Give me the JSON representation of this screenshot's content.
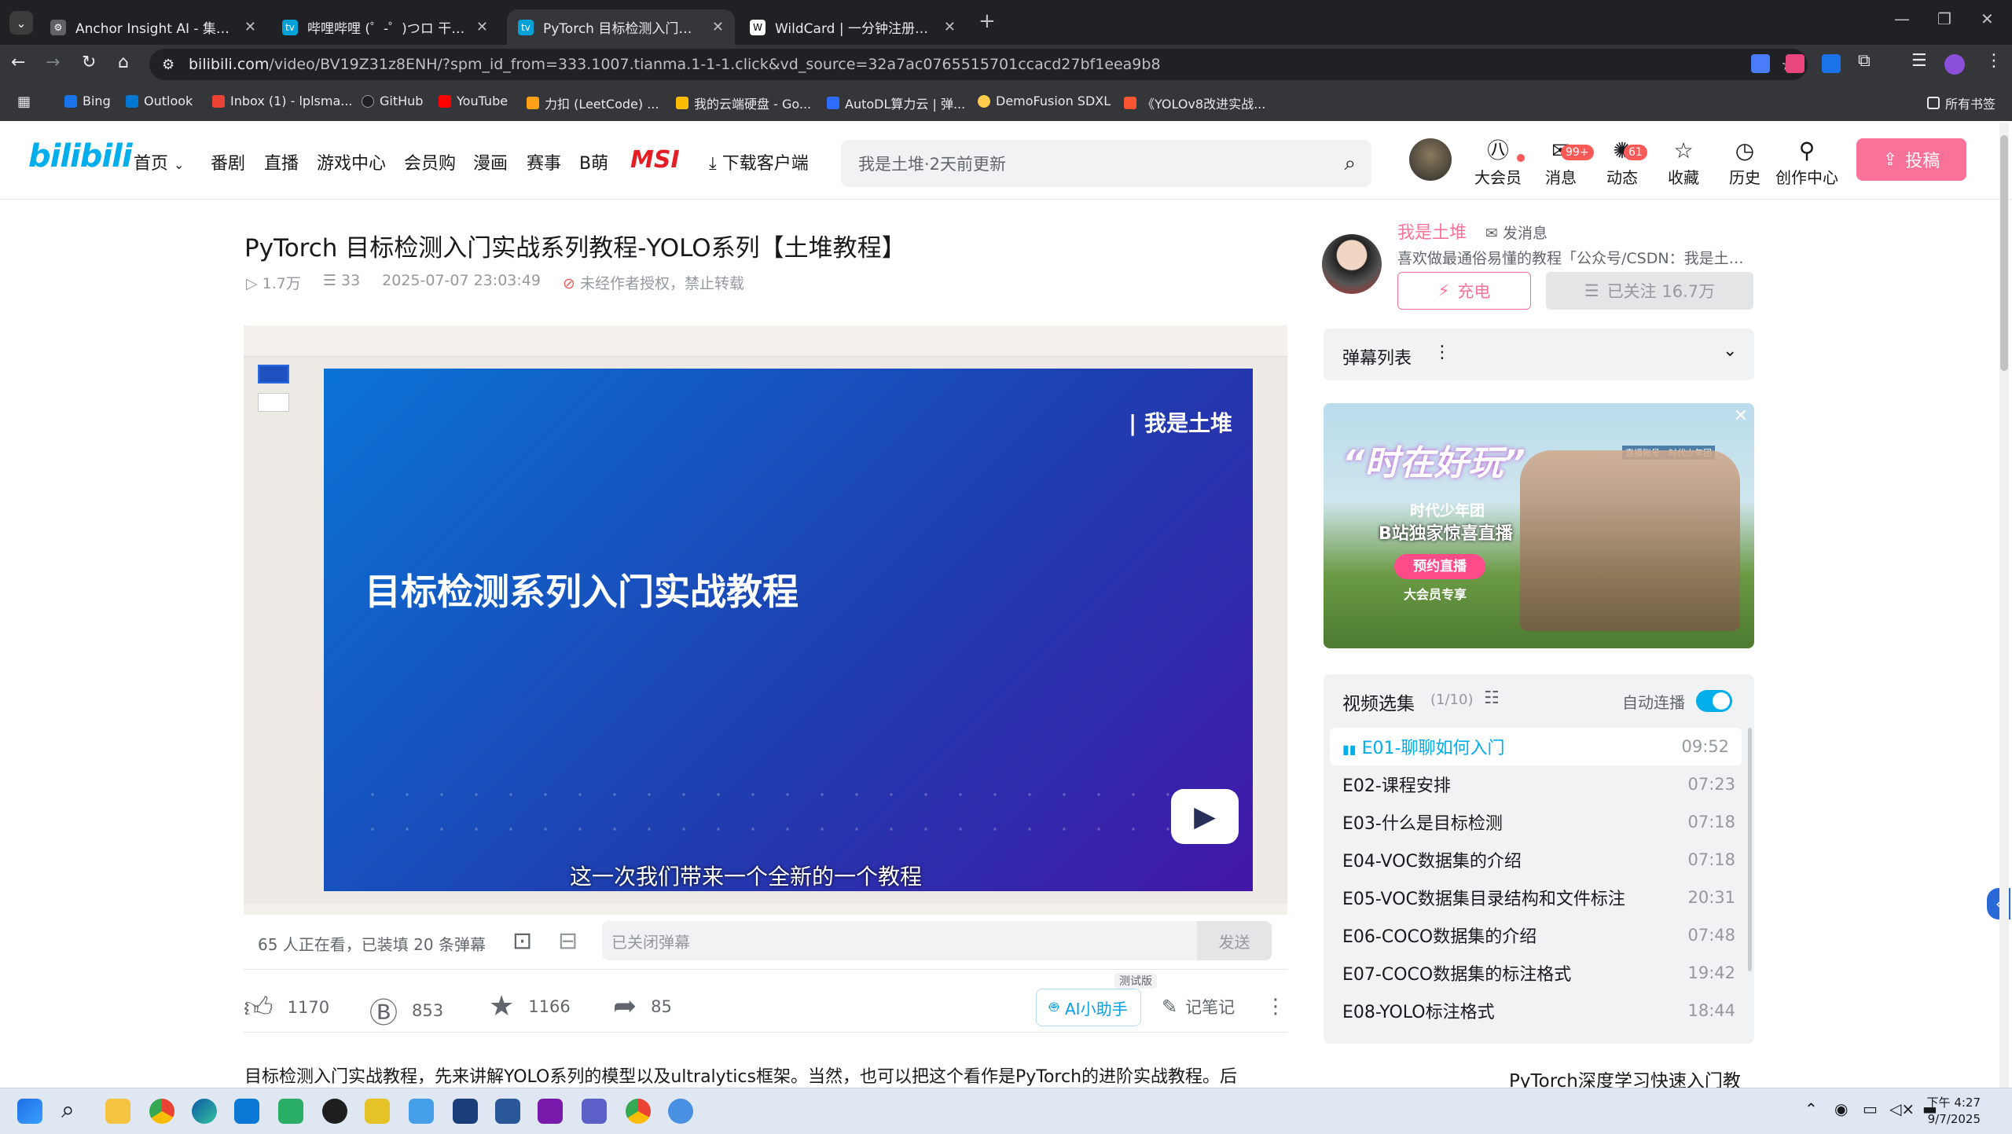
{
  "browser": {
    "tabs": [
      {
        "title": "Anchor Insight AI - 集中注意力",
        "color": "#5f6368",
        "active": false
      },
      {
        "title": "哔哩哔哩 (゜-゜)つロ 干杯~-bilibili",
        "color": "#00a1d6",
        "active": false
      },
      {
        "title": "PyTorch 目标检测入门实战系列教程",
        "color": "#00a1d6",
        "active": true
      },
      {
        "title": "WildCard | 一分钟注册，轻松订阅",
        "color": "#ffffff",
        "active": false
      }
    ],
    "url_host": "bilibili.com",
    "url_path": "/video/BV19Z31z8ENH/?spm_id_from=333.1007.tianma.1-1-1.click&vd_source=32a7ac0765515701ccacd27bf1eea9b8",
    "bookmarks": [
      {
        "label": "Bing",
        "color": "#1a73e8"
      },
      {
        "label": "Outlook",
        "color": "#0078d4"
      },
      {
        "label": "Inbox (1) - lplsma...",
        "color": "#ea4335"
      },
      {
        "label": "GitHub",
        "color": "#202124"
      },
      {
        "label": "YouTube",
        "color": "#ff0000"
      },
      {
        "label": "力扣 (LeetCode) ...",
        "color": "#ffa116"
      },
      {
        "label": "我的云端硬盘 - Go...",
        "color": "#fbbc04"
      },
      {
        "label": "AutoDL算力云 | 弹...",
        "color": "#2e6bff"
      },
      {
        "label": "DemoFusion SDXL",
        "color": "#ffcc4d"
      },
      {
        "label": "《YOLOv8改进实战...",
        "color": "#fc5531"
      }
    ],
    "all_bookmarks": "所有书签"
  },
  "header": {
    "logo": "bilibili",
    "nav": [
      "首页",
      "番剧",
      "直播",
      "游戏中心",
      "会员购",
      "漫画",
      "赛事",
      "B萌",
      "MSI",
      "下载客户端"
    ],
    "search_placeholder": "我是土堆·2天前更新",
    "icons": [
      {
        "label": "大会员",
        "icon": "vip-icon",
        "glyph": "㊇"
      },
      {
        "label": "消息",
        "icon": "message-icon",
        "glyph": "✉",
        "badge": "99+"
      },
      {
        "label": "动态",
        "icon": "dynamic-icon",
        "glyph": "✺",
        "badge": "61"
      },
      {
        "label": "收藏",
        "icon": "favorite-icon",
        "glyph": "☆"
      },
      {
        "label": "历史",
        "icon": "history-icon",
        "glyph": "◷"
      },
      {
        "label": "创作中心",
        "icon": "creator-icon",
        "glyph": "⚲"
      }
    ],
    "upload": "投稿"
  },
  "video": {
    "title": "PyTorch 目标检测入门实战系列教程-YOLO系列【土堆教程】",
    "views": "1.7万",
    "danmaku_count": "33",
    "date": "2025-07-07 23:03:49",
    "copyright": "未经作者授权，禁止转载",
    "slide_header": "| 我是土堆",
    "slide_title": "目标检测系列入门实战教程",
    "subtitle": "这一次我们带来一个全新的一个教程"
  },
  "danmaku_bar": {
    "watching": "65 人正在看，已装填 20 条弹幕",
    "placeholder": "已关闭弹幕",
    "send": "发送"
  },
  "toolbar": {
    "like": "1170",
    "coin": "853",
    "favorite": "1166",
    "share": "85",
    "ai_tag": "测试版",
    "ai_label": "AI小助手",
    "notes": "记笔记"
  },
  "description": "目标检测入门实战教程，先来讲解YOLO系列的模型以及ultralytics框架。当然，也可以把这个看作是PyTorch的进阶实战教程。后",
  "uploader": {
    "name": "我是土堆",
    "message": "发消息",
    "desc": "喜欢做最通俗易懂的教程「公众号/CSDN：我是土堆」",
    "charge": "充电",
    "follow": "已关注 16.7万"
  },
  "danmaku_list": {
    "title": "弹幕列表"
  },
  "ad": {
    "slogan": "“时在好玩”",
    "group": "时代少年团",
    "line": "B站独家惊喜直播",
    "button": "预约直播",
    "sub": "大会员专享",
    "corner": "直播账号：时代少年团"
  },
  "episodes": {
    "title": "视频选集",
    "count": "(1/10)",
    "autoplay": "自动连播",
    "items": [
      {
        "title": "E01-聊聊如何入门",
        "duration": "09:52"
      },
      {
        "title": "E02-课程安排",
        "duration": "07:23"
      },
      {
        "title": "E03-什么是目标检测",
        "duration": "07:18"
      },
      {
        "title": "E04-VOC数据集的介绍",
        "duration": "07:18"
      },
      {
        "title": "E05-VOC数据集目录结构和文件标注",
        "duration": "20:31"
      },
      {
        "title": "E06-COCO数据集的介绍",
        "duration": "07:48"
      },
      {
        "title": "E07-COCO数据集的标注格式",
        "duration": "19:42"
      },
      {
        "title": "E08-YOLO标注格式",
        "duration": "18:44"
      }
    ]
  },
  "related": {
    "title": "PyTorch深度学习快速入门教"
  },
  "taskbar": {
    "time": "下午 4:27",
    "date": "9/7/2025"
  }
}
